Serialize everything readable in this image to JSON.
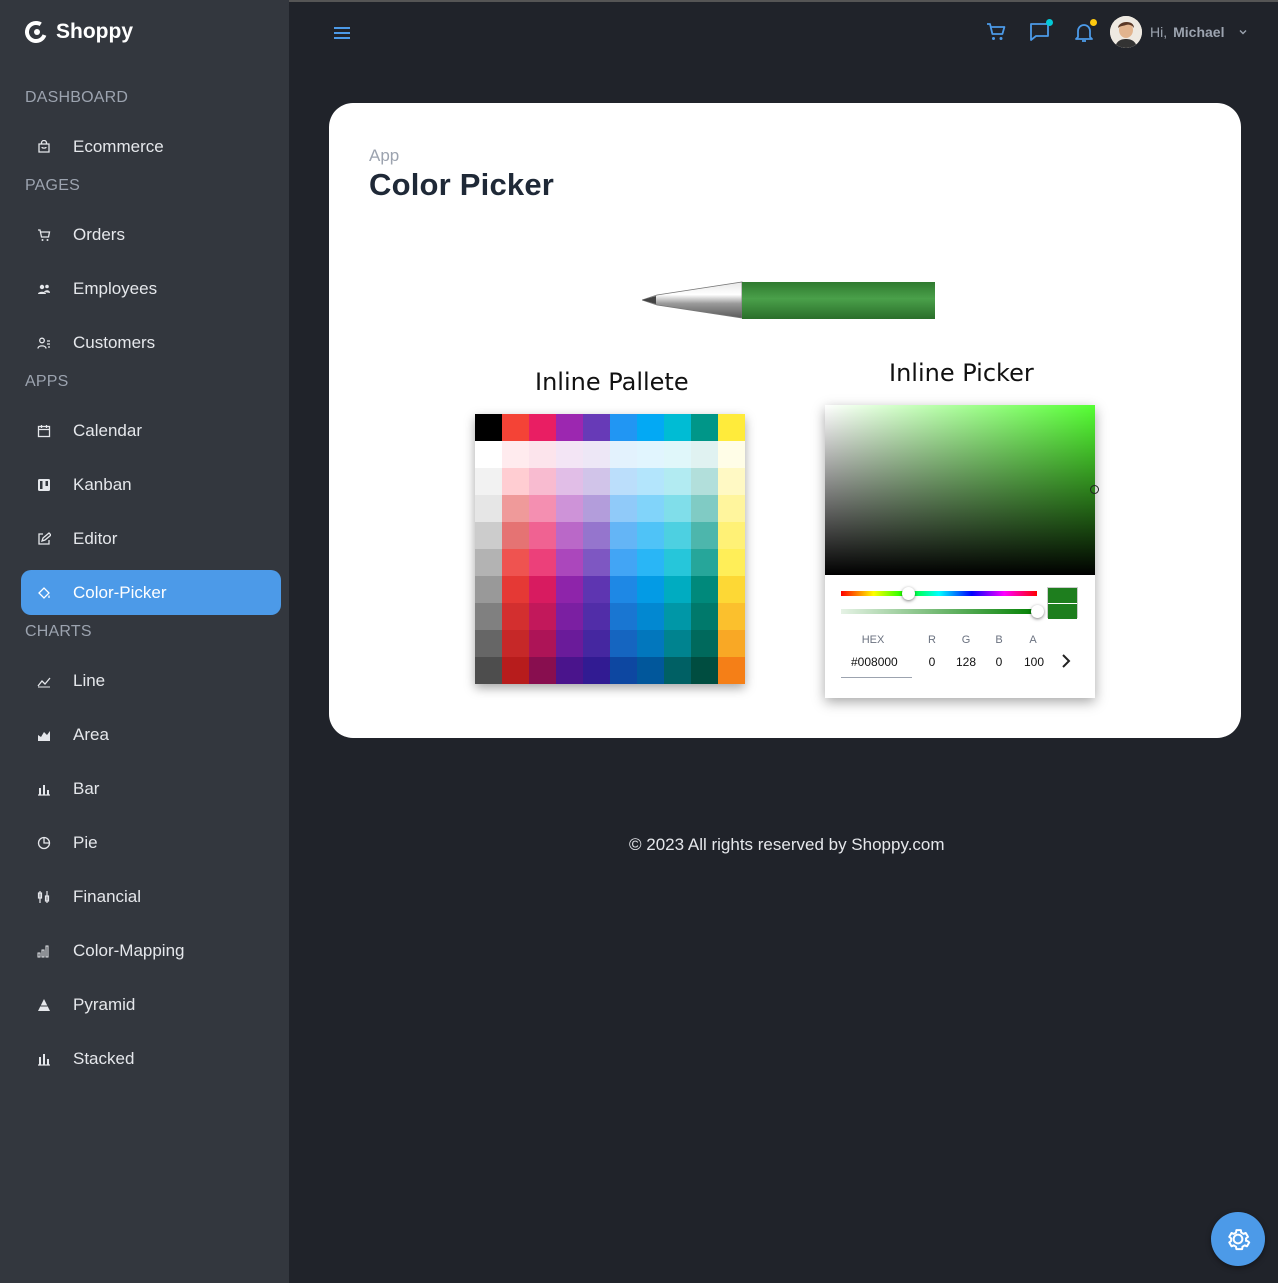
{
  "brand": {
    "name": "Shoppy"
  },
  "sidebar": {
    "sections": [
      {
        "title": "DASHBOARD",
        "items": [
          {
            "label": "Ecommerce",
            "icon": "shopping-bag-icon"
          }
        ]
      },
      {
        "title": "PAGES",
        "items": [
          {
            "label": "Orders",
            "icon": "cart-icon"
          },
          {
            "label": "Employees",
            "icon": "people-icon"
          },
          {
            "label": "Customers",
            "icon": "user-list-icon"
          }
        ]
      },
      {
        "title": "APPS",
        "items": [
          {
            "label": "Calendar",
            "icon": "calendar-icon"
          },
          {
            "label": "Kanban",
            "icon": "kanban-icon"
          },
          {
            "label": "Editor",
            "icon": "edit-icon"
          },
          {
            "label": "Color-Picker",
            "icon": "paint-bucket-icon",
            "active": true
          }
        ]
      },
      {
        "title": "CHARTS",
        "items": [
          {
            "label": "Line",
            "icon": "line-chart-icon"
          },
          {
            "label": "Area",
            "icon": "area-chart-icon"
          },
          {
            "label": "Bar",
            "icon": "bar-chart-icon"
          },
          {
            "label": "Pie",
            "icon": "pie-chart-icon"
          },
          {
            "label": "Financial",
            "icon": "financial-icon"
          },
          {
            "label": "Color-Mapping",
            "icon": "signal-bars-icon"
          },
          {
            "label": "Pyramid",
            "icon": "pyramid-icon"
          },
          {
            "label": "Stacked",
            "icon": "stacked-chart-icon"
          }
        ]
      }
    ]
  },
  "topbar": {
    "greeting": "Hi,",
    "user_name": "Michael",
    "accent": "#4c9ae8",
    "chat_dot_color": "#03c9d7",
    "notification_dot_color": "#fec90f"
  },
  "page": {
    "breadcrumb": "App",
    "title": "Color Picker",
    "pen_color": "#008000"
  },
  "palette": {
    "title": "Inline Pallete",
    "columns": [
      [
        "#000000",
        "#ffffff",
        "#f2f2f2",
        "#e6e6e6",
        "#cccccc",
        "#b3b3b3",
        "#999999",
        "#808080",
        "#666666",
        "#4d4d4d"
      ],
      [
        "#f44336",
        "#ffebee",
        "#ffcdd2",
        "#ef9a9a",
        "#e57373",
        "#ef5350",
        "#e53935",
        "#d32f2f",
        "#c62828",
        "#b71c1c"
      ],
      [
        "#e91e63",
        "#fce4ec",
        "#f8bbd0",
        "#f48fb1",
        "#f06292",
        "#ec407a",
        "#d81b60",
        "#c2185b",
        "#ad1457",
        "#880e4f"
      ],
      [
        "#9c27b0",
        "#f3e5f5",
        "#e1bee7",
        "#ce93d8",
        "#ba68c8",
        "#ab47bc",
        "#8e24aa",
        "#7b1fa2",
        "#6a1b9a",
        "#4a148c"
      ],
      [
        "#673ab7",
        "#ede7f6",
        "#d1c4e9",
        "#b39ddb",
        "#9575cd",
        "#7e57c2",
        "#5e35b1",
        "#512da8",
        "#4527a0",
        "#311b92"
      ],
      [
        "#2196f3",
        "#e3f2fd",
        "#bbdefb",
        "#90caf9",
        "#64b5f6",
        "#42a5f5",
        "#1e88e5",
        "#1976d2",
        "#1565c0",
        "#0d47a1"
      ],
      [
        "#03a9f4",
        "#e1f5fe",
        "#b3e5fc",
        "#81d4fa",
        "#4fc3f7",
        "#29b6f6",
        "#039be5",
        "#0288d1",
        "#0277bd",
        "#01579b"
      ],
      [
        "#00bcd4",
        "#e0f7fa",
        "#b2ebf2",
        "#80deea",
        "#4dd0e1",
        "#26c6da",
        "#00acc1",
        "#0097a7",
        "#00838f",
        "#006064"
      ],
      [
        "#009688",
        "#e0f2f1",
        "#b2dfdb",
        "#80cbc4",
        "#4db6ac",
        "#26a69a",
        "#00897b",
        "#00796b",
        "#00695c",
        "#004d40"
      ],
      [
        "#ffeb3b",
        "#fffde7",
        "#fff9c4",
        "#fff59d",
        "#fff176",
        "#ffee58",
        "#fdd835",
        "#fbc02d",
        "#f9a825",
        "#f57f17"
      ]
    ]
  },
  "picker": {
    "title": "Inline Picker",
    "hex_label": "HEX",
    "hex_value": "#008000",
    "r_label": "R",
    "r_value": "0",
    "g_label": "G",
    "g_value": "128",
    "b_label": "B",
    "b_value": "0",
    "a_label": "A",
    "a_value": "100",
    "hue_fraction": 0.34,
    "alpha_fraction": 1.0
  },
  "footer": {
    "text": "© 2023 All rights reserved by Shoppy.com"
  }
}
